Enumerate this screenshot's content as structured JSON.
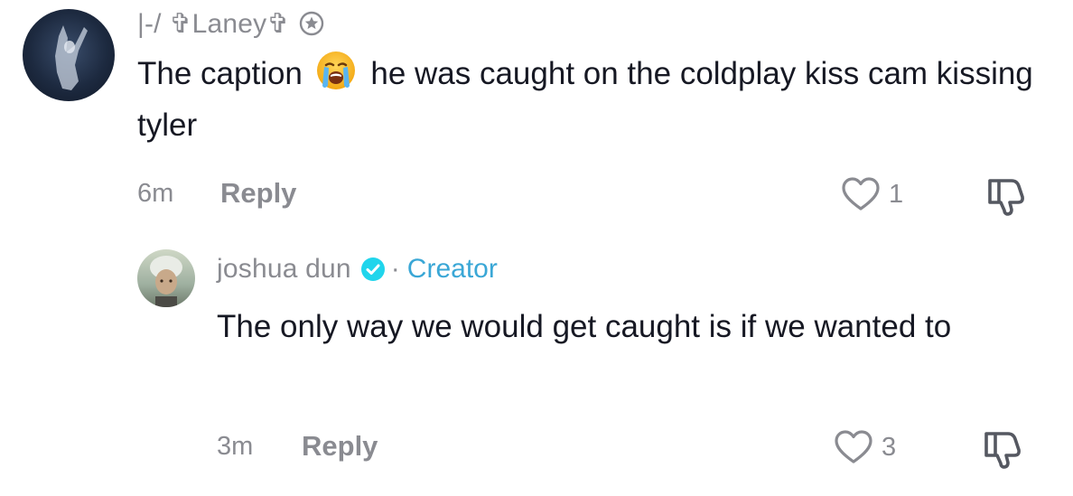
{
  "comments": [
    {
      "username": "|-/ ✞Laney✞",
      "badge_icon": "star-badge-icon",
      "text_before_emoji": "The caption",
      "emoji": "loudly-crying-face-emoji",
      "text_after_emoji": "he was caught on the coldplay kiss cam kissing tyler",
      "time": "6m",
      "reply_label": "Reply",
      "like_count": "1"
    }
  ],
  "reply": {
    "username": "joshua dun",
    "verified_icon": "verified-badge-icon",
    "separator": "·",
    "creator_label": "Creator",
    "text": "The only way we would get caught is if we wanted to",
    "time": "3m",
    "reply_label": "Reply",
    "like_count": "3"
  },
  "colors": {
    "text_primary": "#161823",
    "text_secondary": "#8a8b91",
    "creator_blue": "#3aa7d6",
    "verified_blue": "#20d5ec"
  }
}
